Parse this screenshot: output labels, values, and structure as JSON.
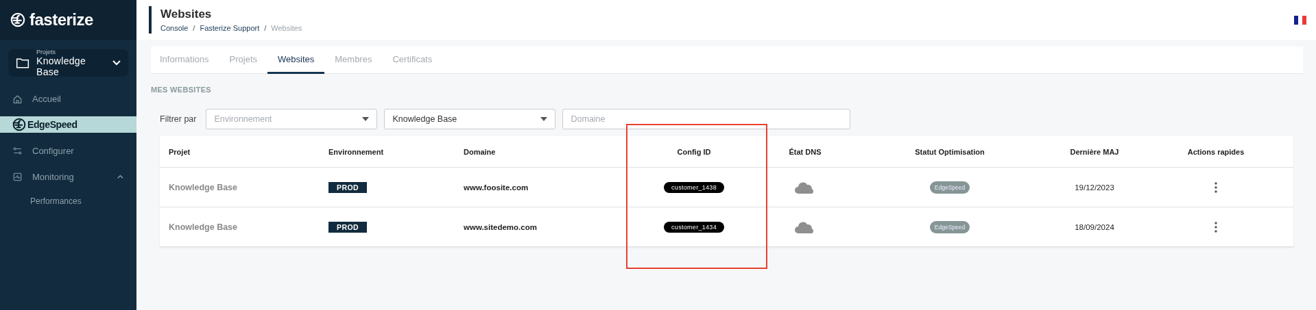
{
  "sidebar": {
    "logo": "fasterize",
    "project_selector": {
      "label": "Projets",
      "value": "Knowledge Base"
    },
    "nav": [
      {
        "kind": "home",
        "label": "Accueil",
        "selected": false
      },
      {
        "kind": "brand",
        "label": "EdgeSpeed",
        "selected": true
      },
      {
        "kind": "config",
        "label": "Configurer",
        "selected": false
      },
      {
        "kind": "monitor",
        "label": "Monitoring",
        "selected": false,
        "expanded": true,
        "children": [
          {
            "label": "Performances",
            "selected": false
          }
        ]
      }
    ]
  },
  "header": {
    "title": "Websites",
    "breadcrumb": [
      {
        "label": "Console",
        "current": false
      },
      {
        "label": "Fasterize Support",
        "current": false
      },
      {
        "label": "Websites",
        "current": true
      }
    ],
    "separator": "/"
  },
  "tabs": [
    {
      "label": "Informations",
      "selected": false
    },
    {
      "label": "Projets",
      "selected": false
    },
    {
      "label": "Websites",
      "selected": true
    },
    {
      "label": "Membres",
      "selected": false
    },
    {
      "label": "Certificats",
      "selected": false
    }
  ],
  "section_title": "MES WEBSITES",
  "filters": {
    "label": "Filtrer par",
    "fields": [
      {
        "kind": "select",
        "placeholder": "Environnement"
      },
      {
        "kind": "select",
        "value": "Knowledge Base"
      },
      {
        "kind": "text",
        "placeholder": "Domaine"
      }
    ]
  },
  "table": {
    "columns": [
      "Projet",
      "Environnement",
      "Domaine",
      "Config ID",
      "État DNS",
      "Statut Optimisation",
      "Dernière MAJ",
      "Actions rapides"
    ],
    "rows": [
      {
        "project": "Knowledge Base",
        "environment": "PROD",
        "domain": "www.foosite.com",
        "config_id": "customer_1438",
        "optimisation": "EdgeSpeed",
        "updated": "19/12/2023"
      },
      {
        "project": "Knowledge Base",
        "environment": "PROD",
        "domain": "www.sitedemo.com",
        "config_id": "customer_1434",
        "optimisation": "EdgeSpeed",
        "updated": "18/09/2024"
      }
    ]
  }
}
